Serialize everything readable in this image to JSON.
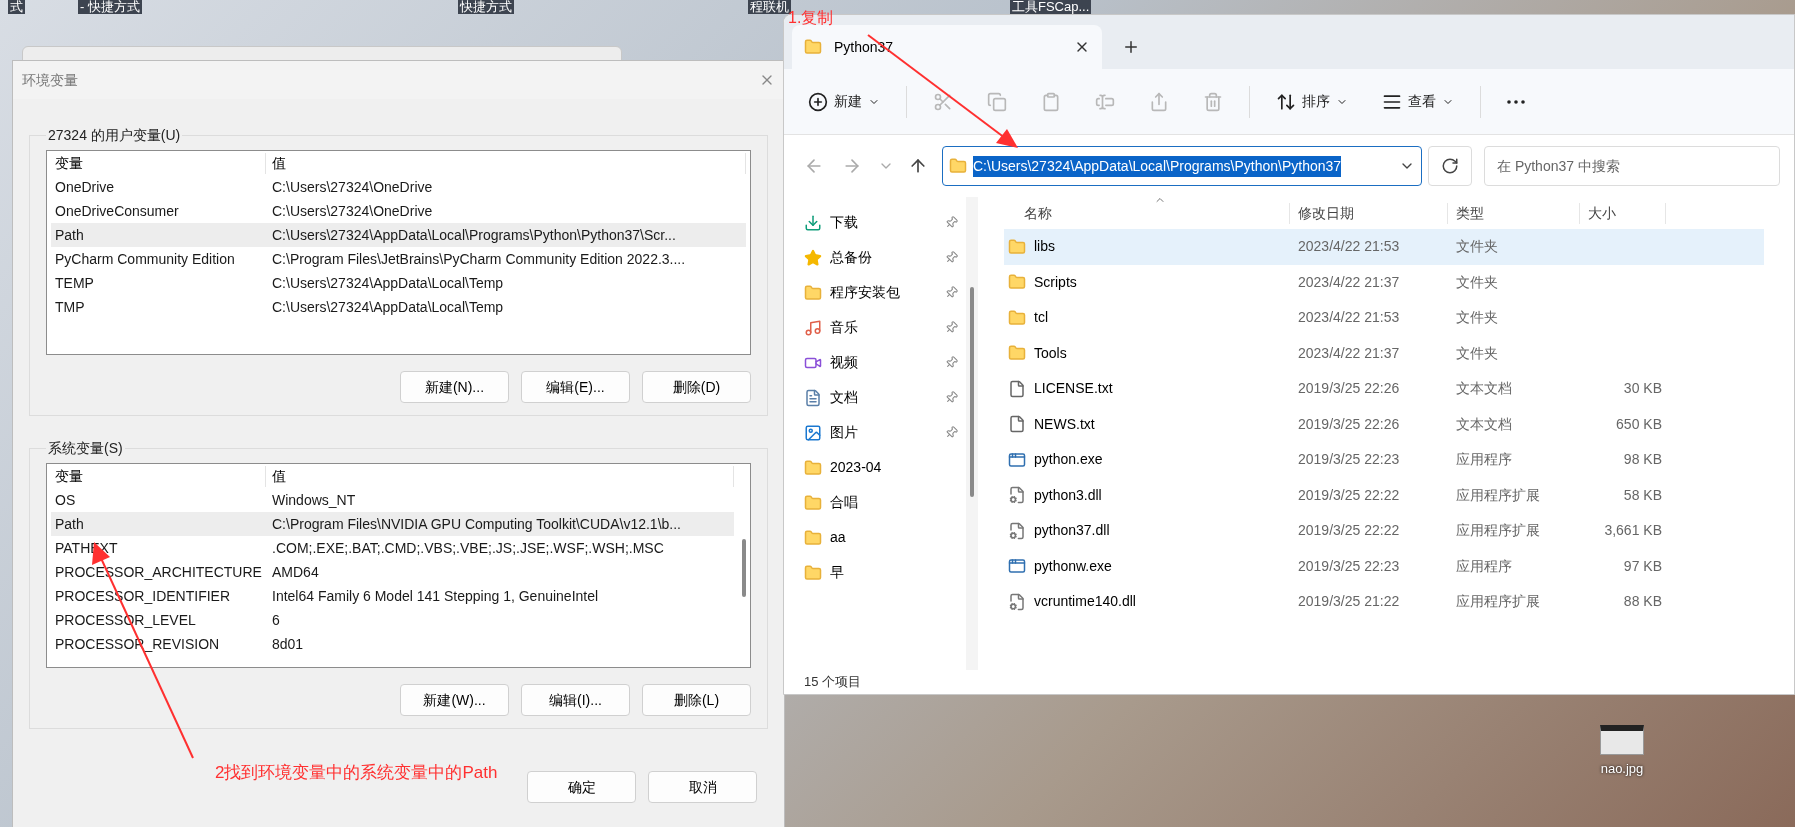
{
  "desktop": {
    "icon_labels": [
      "式",
      "- 快捷方式",
      "快捷方式",
      "程联机",
      "工具FSCap..."
    ],
    "file_icon": {
      "label": "nao.jpg"
    }
  },
  "env_dialog": {
    "title": "环境变量",
    "user_vars": {
      "label": "27324 的用户变量(U)",
      "columns": [
        "变量",
        "值"
      ],
      "rows": [
        {
          "name": "OneDrive",
          "value": "C:\\Users\\27324\\OneDrive",
          "selected": false
        },
        {
          "name": "OneDriveConsumer",
          "value": "C:\\Users\\27324\\OneDrive",
          "selected": false
        },
        {
          "name": "Path",
          "value": "C:\\Users\\27324\\AppData\\Local\\Programs\\Python\\Python37\\Scr...",
          "selected": true
        },
        {
          "name": "PyCharm Community Edition",
          "value": "C:\\Program Files\\JetBrains\\PyCharm Community Edition 2022.3....",
          "selected": false
        },
        {
          "name": "TEMP",
          "value": "C:\\Users\\27324\\AppData\\Local\\Temp",
          "selected": false
        },
        {
          "name": "TMP",
          "value": "C:\\Users\\27324\\AppData\\Local\\Temp",
          "selected": false
        }
      ],
      "buttons": [
        "新建(N)...",
        "编辑(E)...",
        "删除(D)"
      ]
    },
    "system_vars": {
      "label": "系统变量(S)",
      "columns": [
        "变量",
        "值"
      ],
      "rows": [
        {
          "name": "OS",
          "value": "Windows_NT",
          "selected": false
        },
        {
          "name": "Path",
          "value": "C:\\Program Files\\NVIDIA GPU Computing Toolkit\\CUDA\\v12.1\\b...",
          "selected": true
        },
        {
          "name": "PATHEXT",
          "value": ".COM;.EXE;.BAT;.CMD;.VBS;.VBE;.JS;.JSE;.WSF;.WSH;.MSC",
          "selected": false
        },
        {
          "name": "PROCESSOR_ARCHITECTURE",
          "value": "AMD64",
          "selected": false
        },
        {
          "name": "PROCESSOR_IDENTIFIER",
          "value": "Intel64 Family 6 Model 141 Stepping 1, GenuineIntel",
          "selected": false
        },
        {
          "name": "PROCESSOR_LEVEL",
          "value": "6",
          "selected": false
        },
        {
          "name": "PROCESSOR_REVISION",
          "value": "8d01",
          "selected": false
        }
      ],
      "buttons": [
        "新建(W)...",
        "编辑(I)...",
        "删除(L)"
      ]
    },
    "buttons": [
      "确定",
      "取消"
    ]
  },
  "explorer": {
    "tab": {
      "title": "Python37"
    },
    "toolbar": [
      {
        "kind": "new",
        "label": "新建",
        "disabled": false
      },
      {
        "kind": "cut",
        "disabled": true
      },
      {
        "kind": "copy",
        "disabled": true
      },
      {
        "kind": "paste",
        "disabled": true
      },
      {
        "kind": "rename",
        "disabled": true
      },
      {
        "kind": "share",
        "disabled": true
      },
      {
        "kind": "delete",
        "disabled": true
      },
      {
        "kind": "sort",
        "label": "排序",
        "disabled": false
      },
      {
        "kind": "view",
        "label": "查看",
        "disabled": false
      },
      {
        "kind": "more",
        "disabled": false
      }
    ],
    "address": "C:\\Users\\27324\\AppData\\Local\\Programs\\Python\\Python37",
    "search": {
      "placeholder": "在 Python37 中搜索"
    },
    "sidebar": [
      {
        "kind": "download",
        "label": "下载",
        "pinned": true
      },
      {
        "kind": "star",
        "label": "总备份",
        "pinned": true
      },
      {
        "kind": "folder",
        "label": "程序安装包",
        "pinned": true
      },
      {
        "kind": "music",
        "label": "音乐",
        "pinned": true
      },
      {
        "kind": "video",
        "label": "视频",
        "pinned": true
      },
      {
        "kind": "document",
        "label": "文档",
        "pinned": true
      },
      {
        "kind": "picture",
        "label": "图片",
        "pinned": true
      },
      {
        "kind": "folder",
        "label": "2023-04",
        "pinned": false
      },
      {
        "kind": "folder",
        "label": "合唱",
        "pinned": false
      },
      {
        "kind": "folder",
        "label": "aa",
        "pinned": false
      },
      {
        "kind": "folder",
        "label": "早",
        "pinned": false
      }
    ],
    "columns": [
      "名称",
      "修改日期",
      "类型",
      "大小"
    ],
    "rows": [
      {
        "kind": "folder",
        "name": "libs",
        "date": "2023/4/22 21:53",
        "type": "文件夹",
        "selected": true
      },
      {
        "kind": "folder",
        "name": "Scripts",
        "date": "2023/4/22 21:37",
        "type": "文件夹",
        "selected": false
      },
      {
        "kind": "folder",
        "name": "tcl",
        "date": "2023/4/22 21:53",
        "type": "文件夹",
        "selected": false
      },
      {
        "kind": "folder",
        "name": "Tools",
        "date": "2023/4/22 21:37",
        "type": "文件夹",
        "selected": false
      },
      {
        "kind": "text",
        "name": "LICENSE.txt",
        "date": "2019/3/25 22:26",
        "type": "文本文档",
        "size": "30 KB",
        "selected": false
      },
      {
        "kind": "text",
        "name": "NEWS.txt",
        "date": "2019/3/25 22:26",
        "type": "文本文档",
        "size": "650 KB",
        "selected": false
      },
      {
        "kind": "app",
        "name": "python.exe",
        "date": "2019/3/25 22:23",
        "type": "应用程序",
        "size": "98 KB",
        "selected": false
      },
      {
        "kind": "dll",
        "name": "python3.dll",
        "date": "2019/3/25 22:22",
        "type": "应用程序扩展",
        "size": "58 KB",
        "selected": false
      },
      {
        "kind": "dll",
        "name": "python37.dll",
        "date": "2019/3/25 22:22",
        "type": "应用程序扩展",
        "size": "3,661 KB",
        "selected": false
      },
      {
        "kind": "app",
        "name": "pythonw.exe",
        "date": "2019/3/25 22:23",
        "type": "应用程序",
        "size": "97 KB",
        "selected": false
      },
      {
        "kind": "dll",
        "name": "vcruntime140.dll",
        "date": "2019/3/25 21:22",
        "type": "应用程序扩展",
        "size": "88 KB",
        "selected": false
      }
    ],
    "status": "15 个项目"
  },
  "annotations": [
    {
      "text": "1.复制"
    },
    {
      "text": "2找到环境变量中的系统变量中的Path"
    }
  ]
}
